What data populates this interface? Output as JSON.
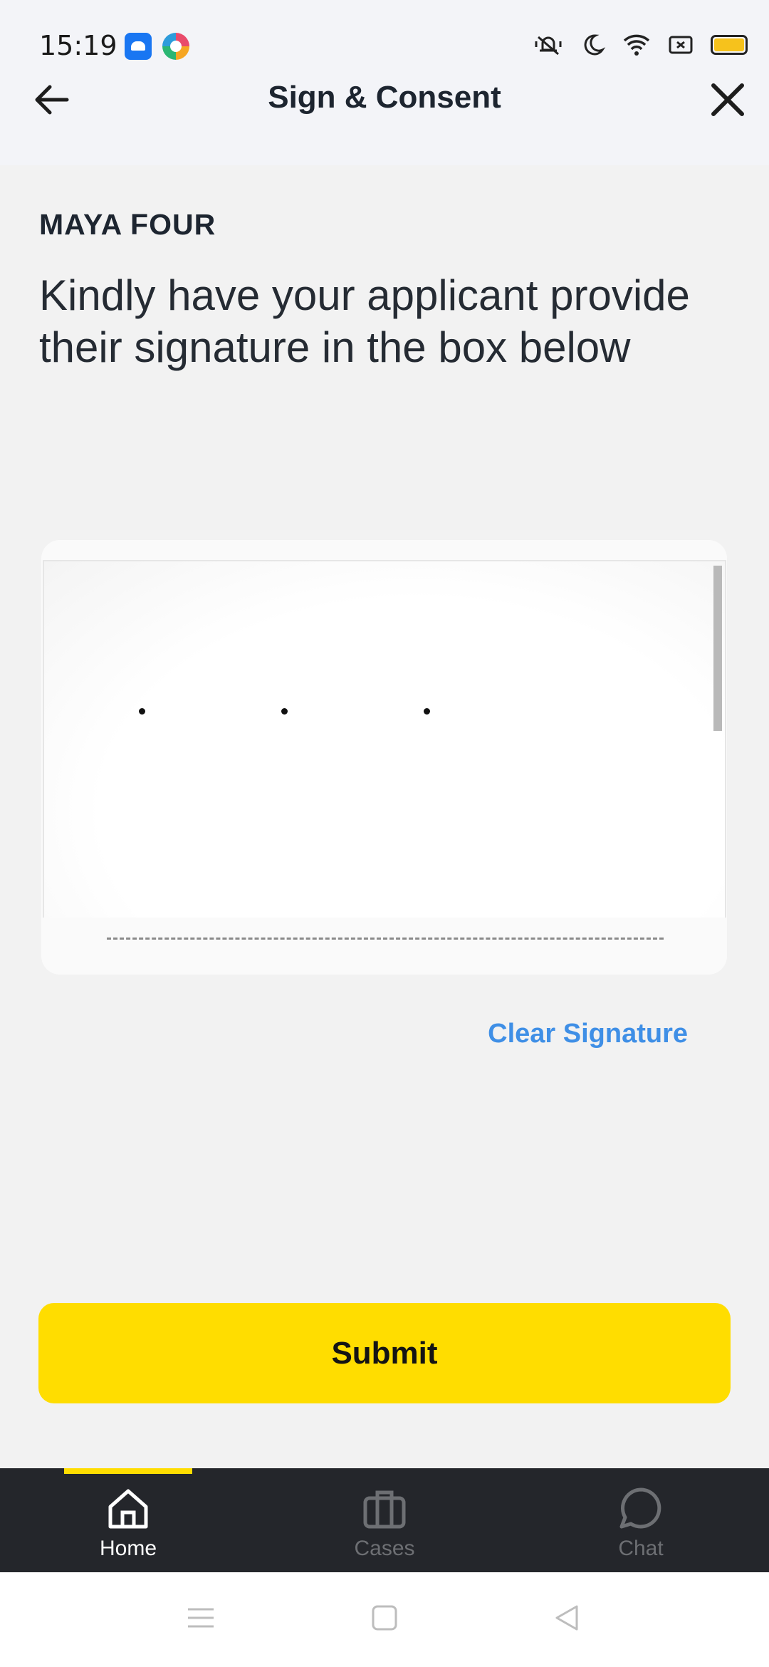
{
  "status_bar": {
    "time": "15:19",
    "icons": [
      "android-app-icon",
      "browser-app-icon",
      "mute-icon",
      "moon-icon",
      "wifi-icon",
      "sim-icon",
      "battery-icon"
    ]
  },
  "header": {
    "title": "Sign & Consent",
    "back_icon": "arrow-left-icon",
    "close_icon": "close-icon"
  },
  "content": {
    "applicant_name": "MAYA FOUR",
    "instruction": "Kindly have your applicant provide their signature in the box below",
    "clear_label": "Clear Signature",
    "submit_label": "Submit"
  },
  "bottom_nav": {
    "items": [
      {
        "label": "Home",
        "icon": "home-icon",
        "active": true
      },
      {
        "label": "Cases",
        "icon": "briefcase-icon",
        "active": false
      },
      {
        "label": "Chat",
        "icon": "chat-bubble-icon",
        "active": false
      }
    ]
  },
  "system_nav": {
    "icons": [
      "menu-icon",
      "home-square-icon",
      "back-triangle-icon"
    ]
  },
  "colors": {
    "accent": "#ffdd00",
    "link": "#3f8fe6",
    "nav_bg": "#24262b"
  }
}
